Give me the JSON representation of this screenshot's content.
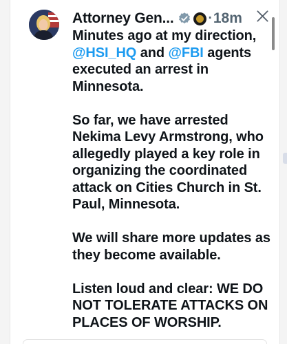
{
  "tweet": {
    "author_name": "Attorney Gen...",
    "separator": "·",
    "time": "18m",
    "paragraphs": [
      {
        "pre": "Minutes ago at my direction, ",
        "mention1": "@HSI_HQ",
        "mid": " and ",
        "mention2": "@FBI",
        "post": " agents executed an arrest in Minnesota."
      }
    ],
    "p2": "So far, we have arrested Nekima Levy Armstrong, who allegedly played a key role in organizing the coordinated attack on Cities Church in St. Paul, Minnesota.",
    "p3": "We will share more updates as they become available.",
    "p4": "Listen loud and clear: WE DO NOT TOLERATE ATTACKS ON PLACES OF WORSHIP."
  },
  "icons": {
    "verified": "verified-badge-icon",
    "seal": "government-seal-icon",
    "close": "x-close-icon"
  },
  "colors": {
    "mention": "#1d9bf0",
    "text": "#0f1419",
    "muted": "#536471",
    "verified_badge": "#829aab"
  }
}
